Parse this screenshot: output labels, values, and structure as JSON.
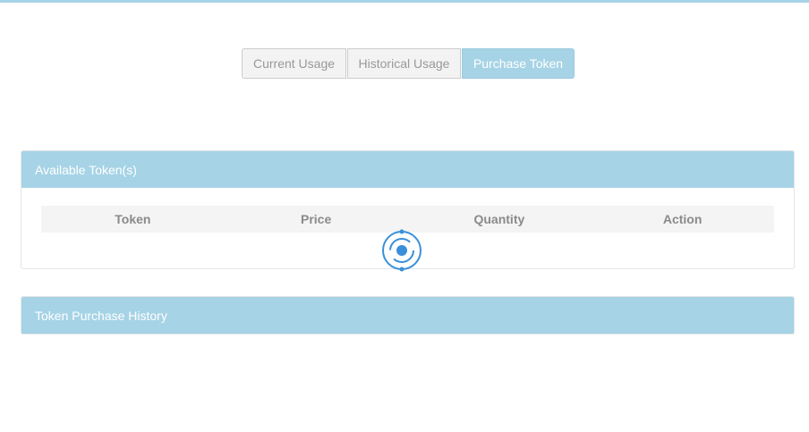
{
  "tabs": [
    {
      "label": "Current Usage",
      "active": false
    },
    {
      "label": "Historical Usage",
      "active": false
    },
    {
      "label": "Purchase Token",
      "active": true
    }
  ],
  "available_tokens": {
    "title": "Available Token(s)",
    "columns": [
      "Token",
      "Price",
      "Quantity",
      "Action"
    ],
    "loading_icon": "loading-spinner-icon"
  },
  "purchase_history": {
    "title": "Token Purchase History"
  },
  "colors": {
    "accent": "#a6d3e6",
    "spinner": "#3a8fd9",
    "header_text": "#8a8a8a"
  }
}
